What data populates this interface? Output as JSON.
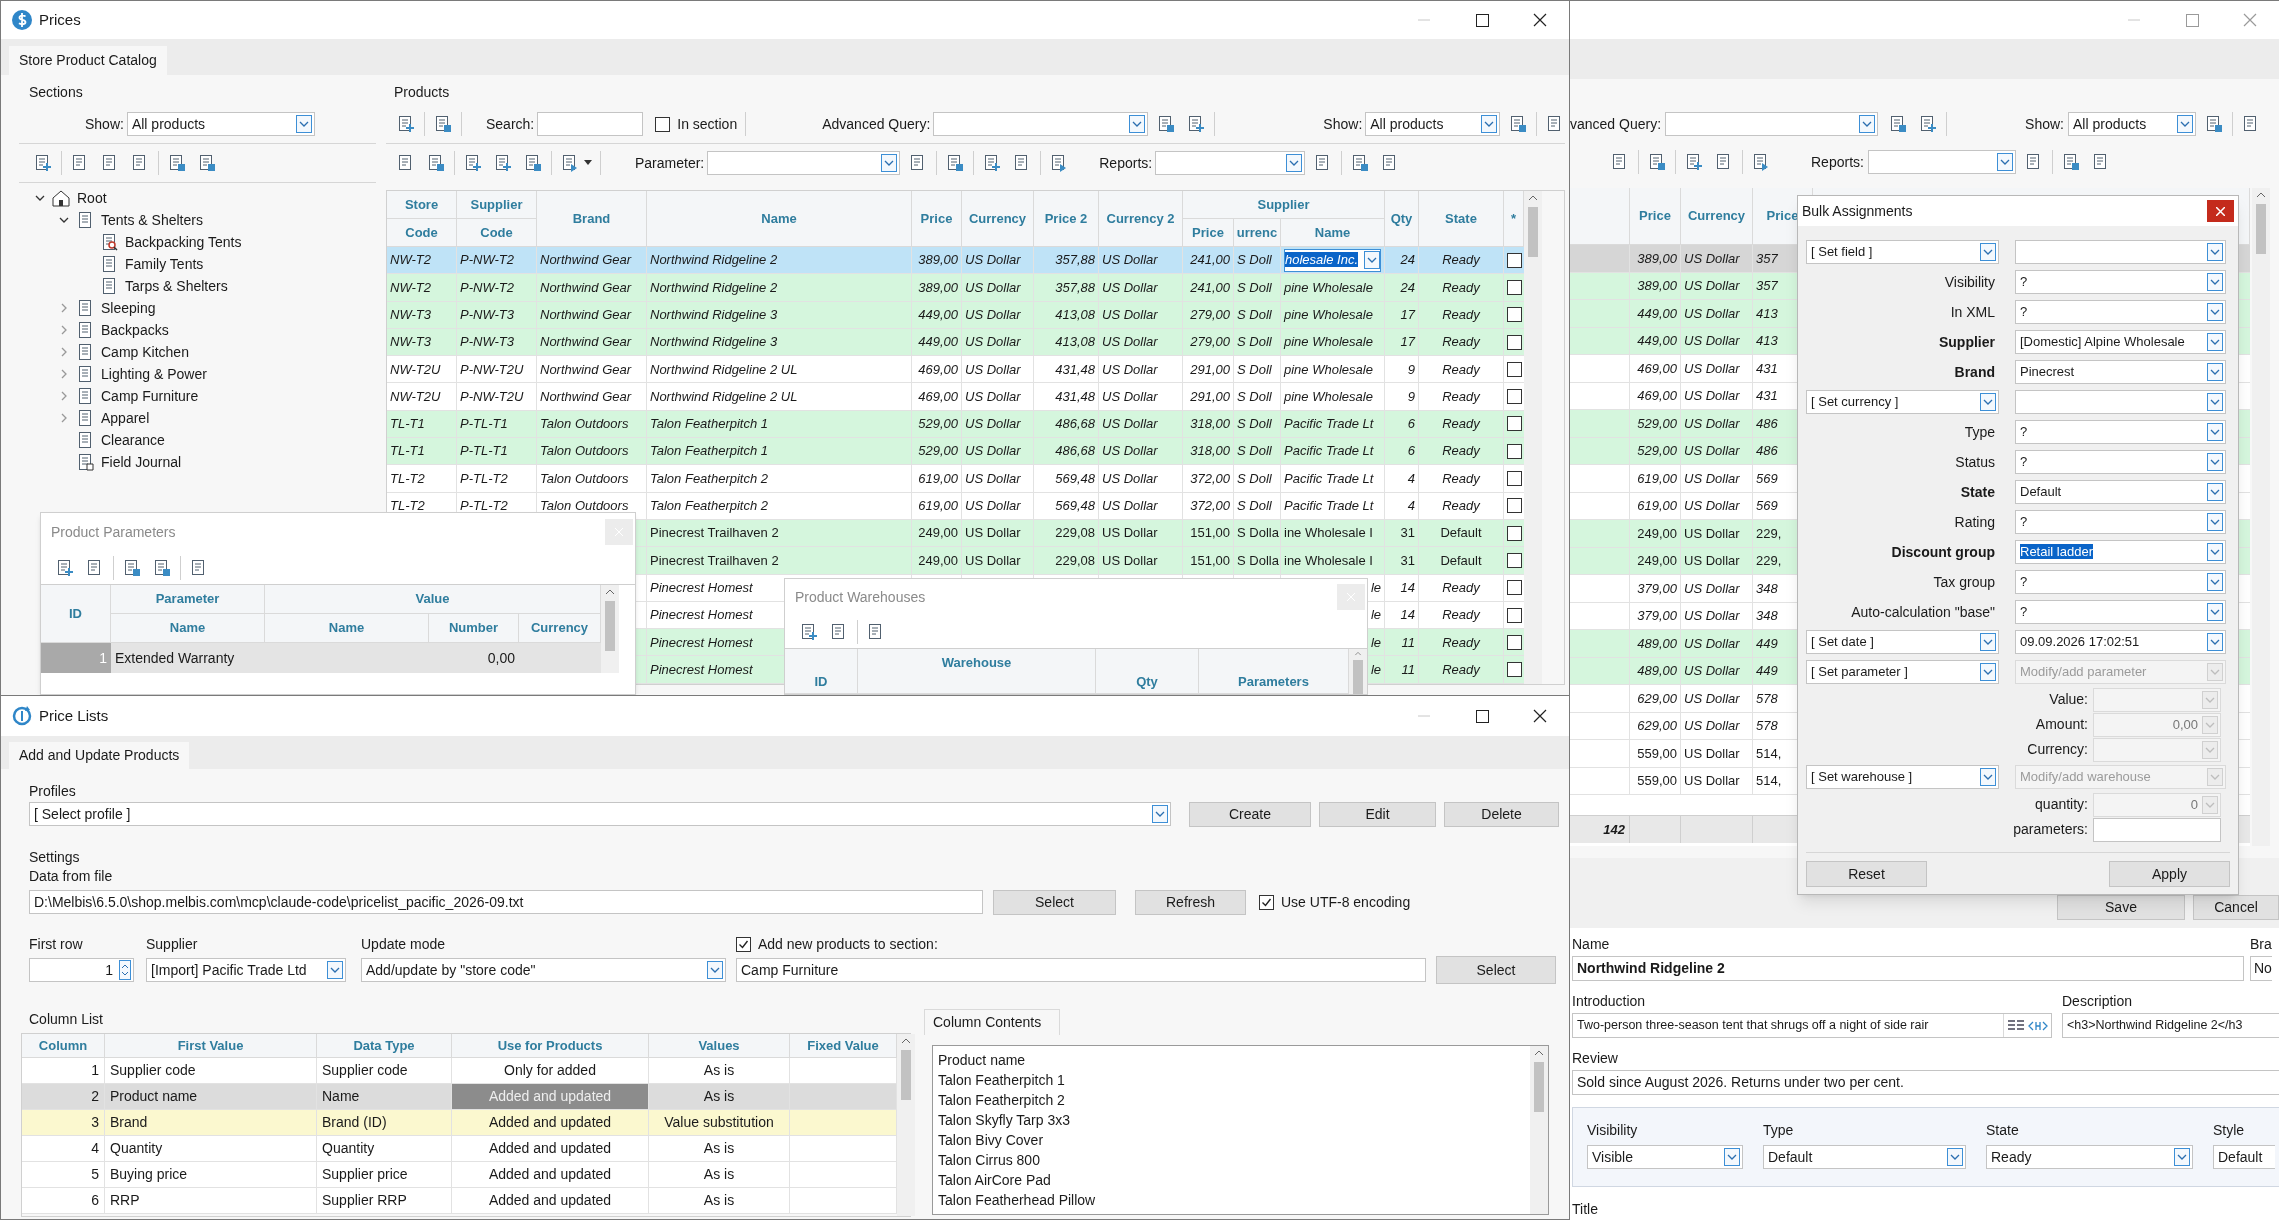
{
  "right_window": {
    "query_label": "vanced Query:",
    "show_label": "Show:",
    "show_value": "All products",
    "reports_label": "Reports:",
    "columns": [
      "Price",
      "Currency",
      "Price"
    ],
    "rows": [
      {
        "price": "389,00",
        "currency": "US Dollar",
        "price2": "357",
        "selected": true,
        "marked": false,
        "kind": "italic"
      },
      {
        "price": "389,00",
        "currency": "US Dollar",
        "price2": "357",
        "selected": false,
        "marked": true,
        "kind": "italic"
      },
      {
        "price": "449,00",
        "currency": "US Dollar",
        "price2": "413",
        "selected": false,
        "marked": true,
        "kind": "italic"
      },
      {
        "price": "449,00",
        "currency": "US Dollar",
        "price2": "413",
        "selected": false,
        "marked": true,
        "kind": "italic"
      },
      {
        "price": "469,00",
        "currency": "US Dollar",
        "price2": "431",
        "selected": false,
        "marked": false,
        "kind": "italic"
      },
      {
        "price": "469,00",
        "currency": "US Dollar",
        "price2": "431",
        "selected": false,
        "marked": false,
        "kind": "italic"
      },
      {
        "price": "529,00",
        "currency": "US Dollar",
        "price2": "486",
        "selected": false,
        "marked": true,
        "kind": "italic"
      },
      {
        "price": "529,00",
        "currency": "US Dollar",
        "price2": "486",
        "selected": false,
        "marked": true,
        "kind": "italic"
      },
      {
        "price": "619,00",
        "currency": "US Dollar",
        "price2": "569",
        "selected": false,
        "marked": false,
        "kind": "italic"
      },
      {
        "price": "619,00",
        "currency": "US Dollar",
        "price2": "569",
        "selected": false,
        "marked": false,
        "kind": "italic"
      },
      {
        "price": "249,00",
        "currency": "US Dollar",
        "price2": "229,",
        "selected": false,
        "marked": true,
        "kind": "regular"
      },
      {
        "price": "249,00",
        "currency": "US Dollar",
        "price2": "229,",
        "selected": false,
        "marked": true,
        "kind": "regular"
      },
      {
        "price": "379,00",
        "currency": "US Dollar",
        "price2": "348",
        "selected": false,
        "marked": false,
        "kind": "italic"
      },
      {
        "price": "379,00",
        "currency": "US Dollar",
        "price2": "348",
        "selected": false,
        "marked": false,
        "kind": "italic"
      },
      {
        "price": "489,00",
        "currency": "US Dollar",
        "price2": "449",
        "selected": false,
        "marked": true,
        "kind": "italic"
      },
      {
        "price": "489,00",
        "currency": "US Dollar",
        "price2": "449",
        "selected": false,
        "marked": true,
        "kind": "italic"
      },
      {
        "price": "629,00",
        "currency": "US Dollar",
        "price2": "578",
        "selected": false,
        "marked": false,
        "kind": "italic"
      },
      {
        "price": "629,00",
        "currency": "US Dollar",
        "price2": "578",
        "selected": false,
        "marked": false,
        "kind": "italic"
      },
      {
        "price": "559,00",
        "currency": "US Dollar",
        "price2": "514,",
        "selected": false,
        "marked": false,
        "kind": "regular"
      },
      {
        "price": "559,00",
        "currency": "US Dollar",
        "price2": "514,",
        "selected": false,
        "marked": false,
        "kind": "regular"
      }
    ],
    "total": "142",
    "save": "Save",
    "cancel": "Cancel",
    "name_label": "Name",
    "name_value": "Northwind Ridgeline 2",
    "brand_label": "Bra",
    "brand_value": "No",
    "intro_label": "Introduction",
    "intro_value": "Two-person three-season tent that shrugs off a night of side rair",
    "description_label": "Description",
    "description_value": "<h3>Northwind Ridgeline 2</h3",
    "review_label": "Review",
    "review_value": "Sold since August 2026. Returns under two per cent.",
    "props": [
      {
        "label": "Visibility",
        "value": "Visible"
      },
      {
        "label": "Type",
        "value": "Default"
      },
      {
        "label": "State",
        "value": "Ready"
      },
      {
        "label": "Style",
        "value": "Default"
      }
    ],
    "title_label": "Title"
  },
  "prices_window": {
    "title": "Prices",
    "tab": "Store Product Catalog",
    "sections": {
      "title": "Sections",
      "show_label": "Show:",
      "show_value": "All products",
      "tree": [
        {
          "label": "Root",
          "kind": "root",
          "expanded": true,
          "children": [
            {
              "label": "Tents & Shelters",
              "kind": "section",
              "expanded": true,
              "children": [
                {
                  "label": "Backpacking Tents",
                  "kind": "filter"
                },
                {
                  "label": "Family Tents",
                  "kind": "section"
                },
                {
                  "label": "Tarps & Shelters",
                  "kind": "section"
                }
              ]
            },
            {
              "label": "Sleeping",
              "kind": "section",
              "expanded": false
            },
            {
              "label": "Backpacks",
              "kind": "section",
              "expanded": false
            },
            {
              "label": "Camp Kitchen",
              "kind": "section",
              "expanded": false
            },
            {
              "label": "Lighting & Power",
              "kind": "section",
              "expanded": false
            },
            {
              "label": "Camp Furniture",
              "kind": "section",
              "expanded": false
            },
            {
              "label": "Apparel",
              "kind": "section",
              "expanded": false
            },
            {
              "label": "Clearance",
              "kind": "section"
            },
            {
              "label": "Field Journal",
              "kind": "journal"
            }
          ]
        }
      ]
    },
    "products": {
      "title": "Products",
      "search_label": "Search:",
      "in_section": {
        "label": "In section",
        "checked": false
      },
      "query_label": "Advanced Query:",
      "show_label": "Show:",
      "show_value": "All products",
      "parameter_label": "Parameter:",
      "reports_label": "Reports:",
      "header": [
        {
          "kind": "stacked",
          "top": "Store",
          "bottom": "Code"
        },
        {
          "kind": "stacked",
          "top": "Supplier",
          "bottom": "Code"
        },
        {
          "kind": "single",
          "label": "Brand"
        },
        {
          "kind": "single",
          "label": "Name"
        },
        {
          "kind": "single",
          "label": "Price"
        },
        {
          "kind": "single",
          "label": "Currency"
        },
        {
          "kind": "single",
          "label": "Price 2"
        },
        {
          "kind": "single",
          "label": "Currency 2"
        },
        {
          "kind": "group",
          "label": "Supplier",
          "columns": [
            "Price",
            "urrenc",
            "Name"
          ]
        },
        {
          "kind": "single",
          "label": "Qty"
        },
        {
          "kind": "single",
          "label": "State"
        },
        {
          "kind": "single",
          "label": "*"
        }
      ],
      "rows": [
        {
          "code": "NW-T2",
          "supplier_code": "P-NW-T2",
          "brand": "Northwind Gear",
          "name": "Northwind Ridgeline 2",
          "price": "389,00",
          "currency": "US Dollar",
          "price2": "357,88",
          "currency2": "US Dollar",
          "supplier_price": "241,00",
          "supplier_currency": "S Doll",
          "supplier_name": "holesale Inc.",
          "qty": "24",
          "state": "Ready",
          "checked": false,
          "selected": true,
          "marked": false,
          "kind": "italic"
        },
        {
          "code": "NW-T2",
          "supplier_code": "P-NW-T2",
          "brand": "Northwind Gear",
          "name": "Northwind Ridgeline 2",
          "price": "389,00",
          "currency": "US Dollar",
          "price2": "357,88",
          "currency2": "US Dollar",
          "supplier_price": "241,00",
          "supplier_currency": "S Doll",
          "supplier_name": "pine Wholesale",
          "qty": "24",
          "state": "Ready",
          "checked": false,
          "selected": false,
          "marked": true,
          "kind": "italic"
        },
        {
          "code": "NW-T3",
          "supplier_code": "P-NW-T3",
          "brand": "Northwind Gear",
          "name": "Northwind Ridgeline 3",
          "price": "449,00",
          "currency": "US Dollar",
          "price2": "413,08",
          "currency2": "US Dollar",
          "supplier_price": "279,00",
          "supplier_currency": "S Doll",
          "supplier_name": "pine Wholesale",
          "qty": "17",
          "state": "Ready",
          "checked": false,
          "selected": false,
          "marked": true,
          "kind": "italic"
        },
        {
          "code": "NW-T3",
          "supplier_code": "P-NW-T3",
          "brand": "Northwind Gear",
          "name": "Northwind Ridgeline 3",
          "price": "449,00",
          "currency": "US Dollar",
          "price2": "413,08",
          "currency2": "US Dollar",
          "supplier_price": "279,00",
          "supplier_currency": "S Doll",
          "supplier_name": "pine Wholesale",
          "qty": "17",
          "state": "Ready",
          "checked": false,
          "selected": false,
          "marked": true,
          "kind": "italic"
        },
        {
          "code": "NW-T2U",
          "supplier_code": "P-NW-T2U",
          "brand": "Northwind Gear",
          "name": "Northwind Ridgeline 2 UL",
          "price": "469,00",
          "currency": "US Dollar",
          "price2": "431,48",
          "currency2": "US Dollar",
          "supplier_price": "291,00",
          "supplier_currency": "S Doll",
          "supplier_name": "pine Wholesale",
          "qty": "9",
          "state": "Ready",
          "checked": false,
          "selected": false,
          "marked": false,
          "kind": "italic"
        },
        {
          "code": "NW-T2U",
          "supplier_code": "P-NW-T2U",
          "brand": "Northwind Gear",
          "name": "Northwind Ridgeline 2 UL",
          "price": "469,00",
          "currency": "US Dollar",
          "price2": "431,48",
          "currency2": "US Dollar",
          "supplier_price": "291,00",
          "supplier_currency": "S Doll",
          "supplier_name": "pine Wholesale",
          "qty": "9",
          "state": "Ready",
          "checked": false,
          "selected": false,
          "marked": false,
          "kind": "italic"
        },
        {
          "code": "TL-T1",
          "supplier_code": "P-TL-T1",
          "brand": "Talon Outdoors",
          "name": "Talon Featherpitch 1",
          "price": "529,00",
          "currency": "US Dollar",
          "price2": "486,68",
          "currency2": "US Dollar",
          "supplier_price": "318,00",
          "supplier_currency": "S Doll",
          "supplier_name": "Pacific Trade Lt",
          "qty": "6",
          "state": "Ready",
          "checked": false,
          "selected": false,
          "marked": true,
          "kind": "italic"
        },
        {
          "code": "TL-T1",
          "supplier_code": "P-TL-T1",
          "brand": "Talon Outdoors",
          "name": "Talon Featherpitch 1",
          "price": "529,00",
          "currency": "US Dollar",
          "price2": "486,68",
          "currency2": "US Dollar",
          "supplier_price": "318,00",
          "supplier_currency": "S Doll",
          "supplier_name": "Pacific Trade Lt",
          "qty": "6",
          "state": "Ready",
          "checked": false,
          "selected": false,
          "marked": true,
          "kind": "italic"
        },
        {
          "code": "TL-T2",
          "supplier_code": "P-TL-T2",
          "brand": "Talon Outdoors",
          "name": "Talon Featherpitch 2",
          "price": "619,00",
          "currency": "US Dollar",
          "price2": "569,48",
          "currency2": "US Dollar",
          "supplier_price": "372,00",
          "supplier_currency": "S Doll",
          "supplier_name": "Pacific Trade Lt",
          "qty": "4",
          "state": "Ready",
          "checked": false,
          "selected": false,
          "marked": false,
          "kind": "italic"
        },
        {
          "code": "TL-T2",
          "supplier_code": "P-TL-T2",
          "brand": "Talon Outdoors",
          "name": "Talon Featherpitch 2",
          "price": "619,00",
          "currency": "US Dollar",
          "price2": "569,48",
          "currency2": "US Dollar",
          "supplier_price": "372,00",
          "supplier_currency": "S Doll",
          "supplier_name": "Pacific Trade Lt",
          "qty": "4",
          "state": "Ready",
          "checked": false,
          "selected": false,
          "marked": false,
          "kind": "italic"
        },
        {
          "name": "Pinecrest Trailhaven 2",
          "price": "249,00",
          "currency": "US Dollar",
          "price2": "229,08",
          "currency2": "US Dollar",
          "supplier_price": "151,00",
          "supplier_currency": "S Dolla",
          "supplier_name": "ine Wholesale I",
          "qty": "31",
          "state": "Default",
          "checked": false,
          "selected": false,
          "marked": true,
          "kind": "regular"
        },
        {
          "name": "Pinecrest Trailhaven 2",
          "price": "249,00",
          "currency": "US Dollar",
          "price2": "229,08",
          "currency2": "US Dollar",
          "supplier_price": "151,00",
          "supplier_currency": "S Dolla",
          "supplier_name": "ine Wholesale I",
          "qty": "31",
          "state": "Default",
          "checked": false,
          "selected": false,
          "marked": true,
          "kind": "regular"
        },
        {
          "name": "Pinecrest Homest",
          "supplier_name": "le",
          "qty": "14",
          "state": "Ready",
          "checked": false,
          "selected": false,
          "marked": false,
          "kind": "italic"
        },
        {
          "name": "Pinecrest Homest",
          "supplier_name": "le",
          "qty": "14",
          "state": "Ready",
          "checked": false,
          "selected": false,
          "marked": false,
          "kind": "italic"
        },
        {
          "name": "Pinecrest Homest",
          "supplier_name": "le",
          "qty": "11",
          "state": "Ready",
          "checked": false,
          "selected": false,
          "marked": true,
          "kind": "italic"
        },
        {
          "name": "Pinecrest Homest",
          "supplier_name": "le",
          "qty": "11",
          "state": "Ready",
          "checked": false,
          "selected": false,
          "marked": true,
          "kind": "italic"
        }
      ]
    }
  },
  "product_parameters": {
    "title": "Product Parameters",
    "id_label": "ID",
    "parameter_label": "Parameter",
    "value_label": "Value",
    "columns": [
      "Name",
      "Name",
      "Number",
      "Currency"
    ],
    "rows": [
      {
        "id": "1",
        "name": "Extended Warranty",
        "number": "0,00",
        "selected": true
      }
    ]
  },
  "product_warehouses": {
    "title": "Product Warehouses",
    "columns": [
      "ID",
      "Warehouse",
      "Qty",
      "Parameters"
    ]
  },
  "price_lists": {
    "title": "Price Lists",
    "tab": "Add and Update Products",
    "profiles_label": "Profiles",
    "profile_value": "[ Select profile ]",
    "profile_buttons": [
      "Create",
      "Edit",
      "Delete"
    ],
    "settings_label": "Settings",
    "file_label": "Data from file",
    "file_value": "D:\\Melbis\\6.5.0\\shop.melbis.com\\mcp\\claude-code\\pricelist_pacific_2026-09.txt",
    "select": "Select",
    "refresh": "Refresh",
    "utf8": {
      "label": "Use UTF-8 encoding",
      "checked": true
    },
    "first_row_label": "First row",
    "first_row_value": "1",
    "supplier_label": "Supplier",
    "supplier_value": "[Import] Pacific Trade Ltd",
    "mode_label": "Update mode",
    "mode_value": "Add/update by \"store code\"",
    "add_new": {
      "label": "Add new products to section:",
      "checked": true
    },
    "section_value": "Camp Furniture",
    "section_select": "Select",
    "column_list_label": "Column List",
    "columns": [
      "Column",
      "First Value",
      "Data Type",
      "Use for Products",
      "Values",
      "Fixed Value"
    ],
    "rows": [
      {
        "cells": [
          "1",
          "Supplier code",
          "Supplier code",
          "Only for added",
          "As is"
        ],
        "selected": false,
        "marked": false
      },
      {
        "cells": [
          "2",
          "Product name",
          "Name",
          "Added and updated",
          "As is"
        ],
        "selected": true,
        "marked": false
      },
      {
        "cells": [
          "3",
          "Brand",
          "Brand (ID)",
          "Added and updated",
          "Value substitution"
        ],
        "selected": false,
        "marked": true
      },
      {
        "cells": [
          "4",
          "Quantity",
          "Quantity",
          "Added and updated",
          "As is"
        ],
        "selected": false,
        "marked": false
      },
      {
        "cells": [
          "5",
          "Buying price",
          "Supplier price",
          "Added and updated",
          "As is"
        ],
        "selected": false,
        "marked": false
      },
      {
        "cells": [
          "6",
          "RRP",
          "Supplier RRP",
          "Added and updated",
          "As is"
        ],
        "selected": false,
        "marked": false
      }
    ],
    "contents_tab": "Column Contents",
    "contents": [
      "Product name",
      "Talon Featherpitch 1",
      "Talon Featherpitch 2",
      "Talon Skyfly Tarp 3x3",
      "Talon Bivy Cover",
      "Talon Cirrus 800",
      "Talon AirCore Pad",
      "Talon Featherhead Pillow"
    ]
  },
  "bulk_assignments": {
    "title": "Bulk Assignments",
    "rows": [
      {
        "kind": "select",
        "label": "[ Set field ]",
        "disabled": false
      },
      {
        "kind": "field",
        "label": "Visibility",
        "value": "?",
        "bold": false,
        "focused": false
      },
      {
        "kind": "field",
        "label": "In XML",
        "value": "?",
        "bold": false,
        "focused": false
      },
      {
        "kind": "field",
        "label": "Supplier",
        "value": "[Domestic] Alpine Wholesale",
        "bold": true,
        "focused": false
      },
      {
        "kind": "field",
        "label": "Brand",
        "value": "Pinecrest",
        "bold": true,
        "focused": false
      },
      {
        "kind": "select",
        "label": "[ Set currency ]",
        "disabled": false
      },
      {
        "kind": "field",
        "label": "Type",
        "value": "?",
        "bold": false,
        "focused": false
      },
      {
        "kind": "field",
        "label": "Status",
        "value": "?",
        "bold": false,
        "focused": false
      },
      {
        "kind": "field",
        "label": "State",
        "value": "Default",
        "bold": true,
        "focused": false
      },
      {
        "kind": "field",
        "label": "Rating",
        "value": "?",
        "bold": false,
        "focused": false
      },
      {
        "kind": "field",
        "label": "Discount group",
        "value": "Retail ladder",
        "bold": true,
        "focused": true
      },
      {
        "kind": "field",
        "label": "Tax group",
        "value": "?",
        "bold": false,
        "focused": false
      },
      {
        "kind": "field",
        "label": "Auto-calculation \"base\"",
        "value": "?",
        "bold": false,
        "focused": false
      },
      {
        "kind": "select",
        "label": "[ Set date ]",
        "value": "09.09.2026 17:02:51",
        "disabled": false
      },
      {
        "kind": "select",
        "label": "[ Set parameter ]",
        "placeholder": "Modify/add parameter",
        "disabled": true
      },
      {
        "kind": "sub",
        "label": "Value:",
        "disabled": true
      },
      {
        "kind": "sub",
        "label": "Amount:",
        "value": "0,00",
        "disabled": true
      },
      {
        "kind": "sub",
        "label": "Currency:",
        "disabled": true
      },
      {
        "kind": "select",
        "label": "[ Set warehouse ]",
        "placeholder": "Modify/add warehouse",
        "disabled": true
      },
      {
        "kind": "sub",
        "label": "quantity:",
        "value": "0",
        "disabled": true
      },
      {
        "kind": "sub",
        "label": "parameters:",
        "disabled": false
      }
    ],
    "reset": "Reset",
    "apply": "Apply"
  }
}
